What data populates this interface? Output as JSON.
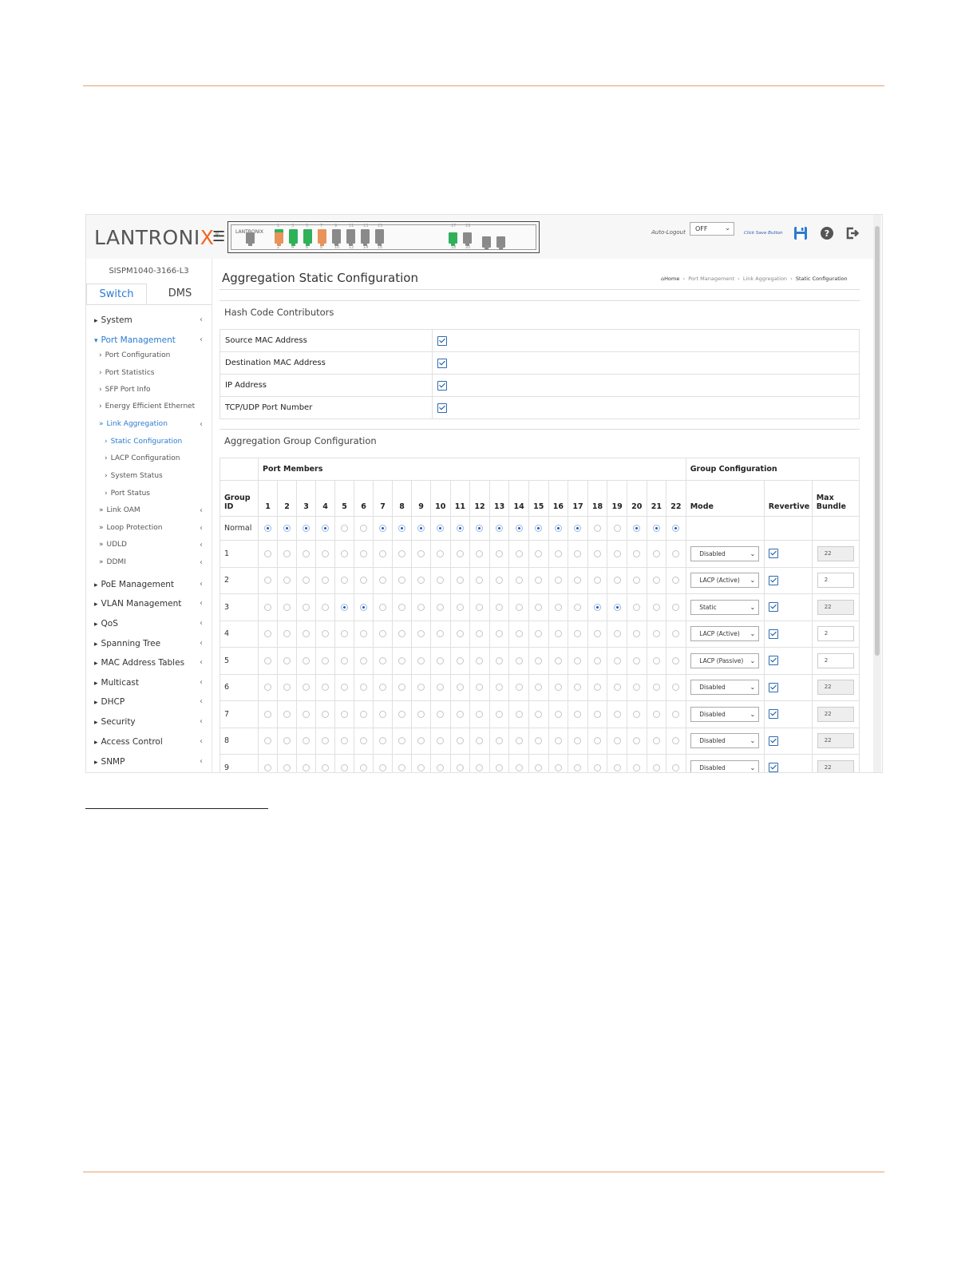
{
  "brand": {
    "logo_text": "LANTRONI",
    "logo_x": "X",
    "model": "SISPM1040-3166-L3",
    "panel_brand": "LANTRONIX"
  },
  "tabs": [
    "Switch",
    "DMS"
  ],
  "header": {
    "auto_logout_label": "Auto-Logout",
    "auto_logout_value": "OFF",
    "save_hint": "Click Save Button"
  },
  "sidebar": {
    "items": [
      {
        "label": "System",
        "level": 0,
        "arrow": "▸",
        "caret": true
      },
      {
        "label": "Port Management",
        "level": 0,
        "arrow": "▾",
        "caret": true,
        "active": true
      },
      {
        "label": "Port Configuration",
        "level": 1,
        "arrow": "›"
      },
      {
        "label": "Port Statistics",
        "level": 1,
        "arrow": "›"
      },
      {
        "label": "SFP Port Info",
        "level": 1,
        "arrow": "›"
      },
      {
        "label": "Energy Efficient Ethernet",
        "level": 1,
        "arrow": "›"
      },
      {
        "label": "Link Aggregation",
        "level": 1,
        "arrow": "»",
        "caret": true,
        "active": true
      },
      {
        "label": "Static Configuration",
        "level": 2,
        "arrow": "›",
        "active": true
      },
      {
        "label": "LACP Configuration",
        "level": 2,
        "arrow": "›"
      },
      {
        "label": "System Status",
        "level": 2,
        "arrow": "›"
      },
      {
        "label": "Port Status",
        "level": 2,
        "arrow": "›"
      },
      {
        "label": "Link OAM",
        "level": 1,
        "arrow": "»",
        "caret": true
      },
      {
        "label": "Loop Protection",
        "level": 1,
        "arrow": "»",
        "caret": true
      },
      {
        "label": "UDLD",
        "level": 1,
        "arrow": "»",
        "caret": true
      },
      {
        "label": "DDMI",
        "level": 1,
        "arrow": "»",
        "caret": true
      },
      {
        "label": "PoE Management",
        "level": 0,
        "arrow": "▸",
        "caret": true
      },
      {
        "label": "VLAN Management",
        "level": 0,
        "arrow": "▸",
        "caret": true
      },
      {
        "label": "QoS",
        "level": 0,
        "arrow": "▸",
        "caret": true
      },
      {
        "label": "Spanning Tree",
        "level": 0,
        "arrow": "▸",
        "caret": true
      },
      {
        "label": "MAC Address Tables",
        "level": 0,
        "arrow": "▸",
        "caret": true
      },
      {
        "label": "Multicast",
        "level": 0,
        "arrow": "▸",
        "caret": true
      },
      {
        "label": "DHCP",
        "level": 0,
        "arrow": "▸",
        "caret": true
      },
      {
        "label": "Security",
        "level": 0,
        "arrow": "▸",
        "caret": true
      },
      {
        "label": "Access Control",
        "level": 0,
        "arrow": "▸",
        "caret": true
      },
      {
        "label": "SNMP",
        "level": 0,
        "arrow": "▸",
        "caret": true
      }
    ]
  },
  "page": {
    "title": "Aggregation Static Configuration"
  },
  "breadcrumb": [
    "Home",
    "Port Management",
    "Link Aggregation",
    "Static Configuration"
  ],
  "hash": {
    "title": "Hash Code Contributors",
    "rows": [
      {
        "label": "Source MAC Address",
        "checked": true
      },
      {
        "label": "Destination MAC Address",
        "checked": true
      },
      {
        "label": "IP Address",
        "checked": true
      },
      {
        "label": "TCP/UDP Port Number",
        "checked": true
      }
    ]
  },
  "agg": {
    "title": "Aggregation Group Configuration",
    "port_members_label": "Port Members",
    "group_config_label": "Group Configuration",
    "group_id_label": "Group ID",
    "mode_label": "Mode",
    "revertive_label": "Revertive",
    "max_bundle_label": "Max Bundle",
    "ports": [
      "1",
      "2",
      "3",
      "4",
      "5",
      "6",
      "7",
      "8",
      "9",
      "10",
      "11",
      "12",
      "13",
      "14",
      "15",
      "16",
      "17",
      "18",
      "19",
      "20",
      "21",
      "22"
    ],
    "normal": {
      "label": "Normal",
      "selected": [
        1,
        2,
        3,
        4,
        7,
        8,
        9,
        10,
        11,
        12,
        13,
        14,
        15,
        16,
        17,
        20,
        21,
        22
      ]
    },
    "groups": [
      {
        "id": "1",
        "selected": [],
        "mode": "Disabled",
        "revertive": true,
        "max_bundle": "22",
        "bundle_enabled": false
      },
      {
        "id": "2",
        "selected": [],
        "mode": "LACP (Active)",
        "revertive": true,
        "max_bundle": "2",
        "bundle_enabled": true
      },
      {
        "id": "3",
        "selected": [
          5,
          6,
          18,
          19
        ],
        "mode": "Static",
        "revertive": true,
        "max_bundle": "22",
        "bundle_enabled": false
      },
      {
        "id": "4",
        "selected": [],
        "mode": "LACP (Active)",
        "revertive": true,
        "max_bundle": "2",
        "bundle_enabled": true
      },
      {
        "id": "5",
        "selected": [],
        "mode": "LACP (Passive)",
        "revertive": true,
        "max_bundle": "2",
        "bundle_enabled": true
      },
      {
        "id": "6",
        "selected": [],
        "mode": "Disabled",
        "revertive": true,
        "max_bundle": "22",
        "bundle_enabled": false
      },
      {
        "id": "7",
        "selected": [],
        "mode": "Disabled",
        "revertive": true,
        "max_bundle": "22",
        "bundle_enabled": false
      },
      {
        "id": "8",
        "selected": [],
        "mode": "Disabled",
        "revertive": true,
        "max_bundle": "22",
        "bundle_enabled": false
      },
      {
        "id": "9",
        "selected": [],
        "mode": "Disabled",
        "revertive": true,
        "max_bundle": "22",
        "bundle_enabled": false
      }
    ]
  },
  "colors": {
    "accent": "#2b7bd1",
    "rule": "#e8a070",
    "port_green": "#2fb15a",
    "port_orange": "#e8935a",
    "port_gray": "#8a8a8a"
  },
  "switch_panel": {
    "top_numbers": [
      "1",
      "3",
      "5",
      "7",
      "9",
      "11",
      "13",
      "15",
      "17",
      "19"
    ],
    "bottom_numbers": [
      "2",
      "4",
      "6",
      "8",
      "10",
      "12",
      "14",
      "16",
      "18",
      "20",
      "21",
      "22"
    ]
  }
}
